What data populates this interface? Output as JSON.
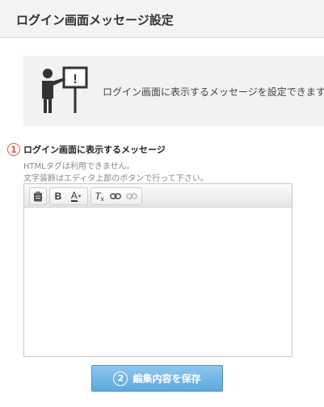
{
  "header": {
    "title": "ログイン画面メッセージ設定"
  },
  "info": {
    "icon": "presenter-board-icon",
    "board_mark": "!",
    "text": "ログイン画面に表示するメッセージを設定できます。"
  },
  "message_section": {
    "step": "1",
    "label": "ログイン画面に表示するメッセージ",
    "notes": [
      "HTMLタグは利用できません。",
      "文字装飾はエディタ上部のボタンで行って下さい。"
    ]
  },
  "editor": {
    "toolbar": {
      "buttons": [
        {
          "icon": "paste-text-icon"
        },
        {
          "icon": "bold-icon",
          "label": "B"
        },
        {
          "icon": "font-color-icon",
          "label": "A"
        },
        {
          "icon": "remove-format-icon",
          "label": "T"
        },
        {
          "icon": "link-icon"
        },
        {
          "icon": "unlink-icon"
        }
      ]
    },
    "content": ""
  },
  "save_button": {
    "step": "2",
    "label": "編集内容を保存"
  },
  "colors": {
    "step_marker": "#e8534b",
    "button_top": "#8dc6ee",
    "button_bottom": "#5ea9dc",
    "info_box_bg": "#f2f2f2",
    "header_bg": "#f4f4f4"
  }
}
